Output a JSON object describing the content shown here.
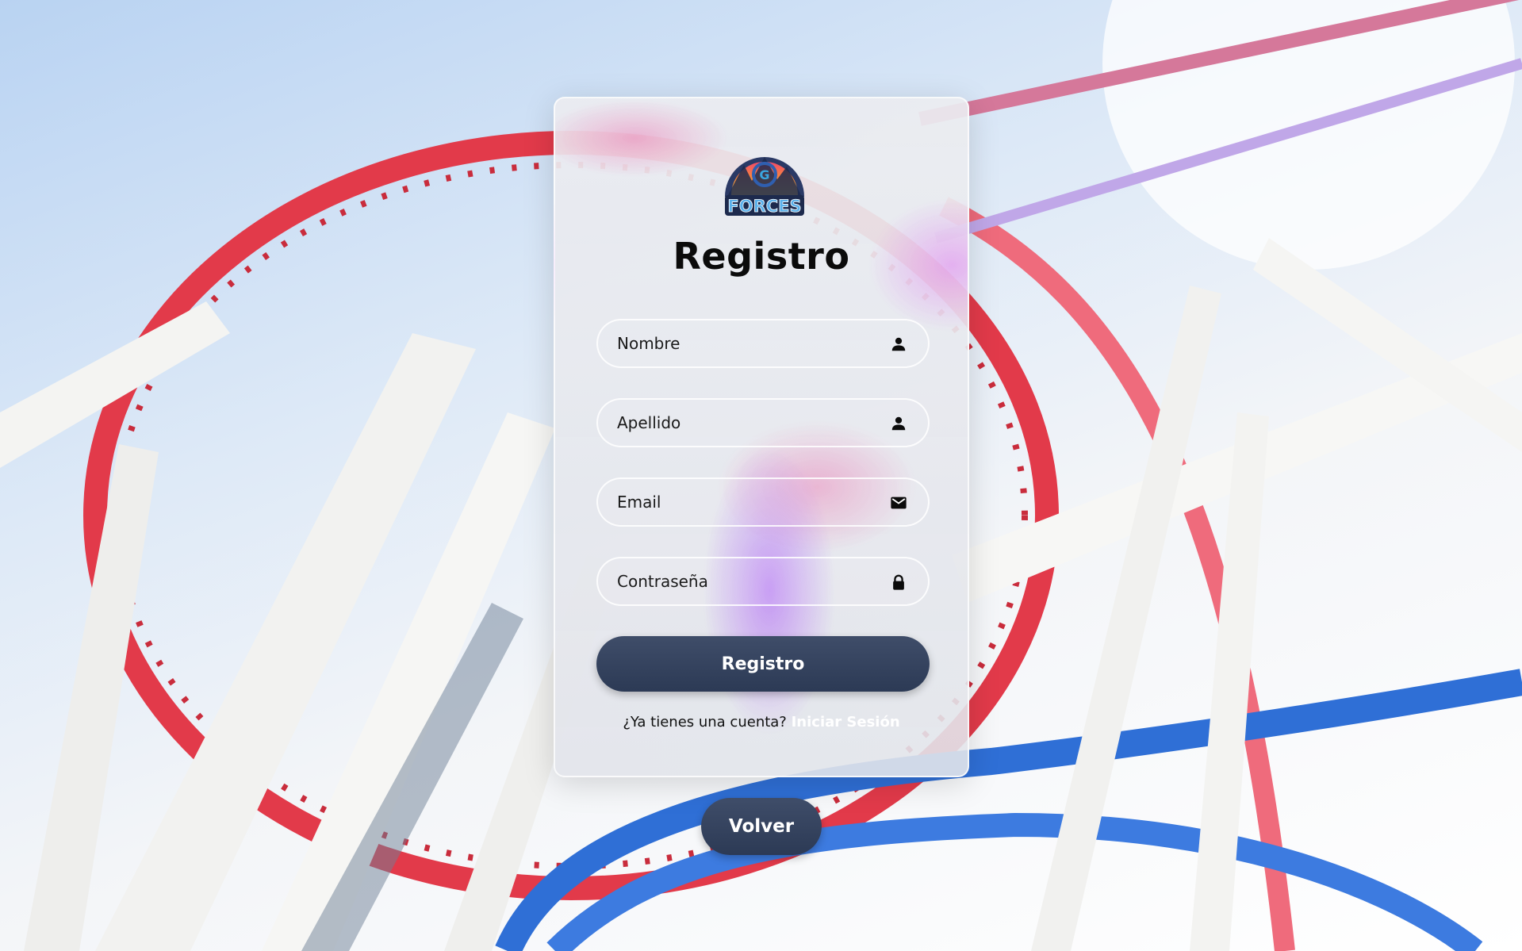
{
  "form": {
    "title": "Registro",
    "logo_text": "FORCES",
    "fields": [
      {
        "placeholder": "Nombre",
        "icon": "user-icon"
      },
      {
        "placeholder": "Apellido",
        "icon": "user-icon"
      },
      {
        "placeholder": "Email",
        "icon": "envelope-icon"
      },
      {
        "placeholder": "Contraseña",
        "icon": "lock-icon"
      }
    ],
    "submit_label": "Registro",
    "login_prompt": "¿Ya tienes una cuenta?",
    "login_link": "Iniciar Sesión"
  },
  "back_label": "Volver",
  "colors": {
    "button": "#2f3d58",
    "rail_red": "#e23a4a",
    "rail_blue": "#2f6fd6",
    "sky": "#bcd5f3"
  }
}
